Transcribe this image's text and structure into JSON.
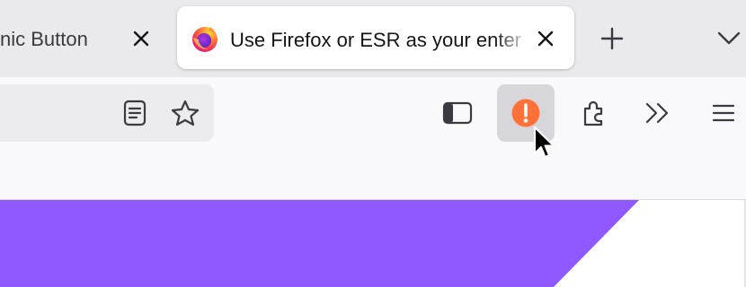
{
  "tabs": [
    {
      "title": "nic Button",
      "active": false
    },
    {
      "title": "Use Firefox or ESR as your enter",
      "active": true
    }
  ],
  "toolbar": {
    "urlbar_icons": [
      "reader-view-icon",
      "bookmark-star-icon"
    ],
    "buttons": [
      "sidebar-icon",
      "alert-extension-icon",
      "extensions-icon",
      "overflow-chevron-icon",
      "menu-icon"
    ]
  },
  "colors": {
    "alert_orange": "#ff7139",
    "page_purple": "#9059ff"
  }
}
